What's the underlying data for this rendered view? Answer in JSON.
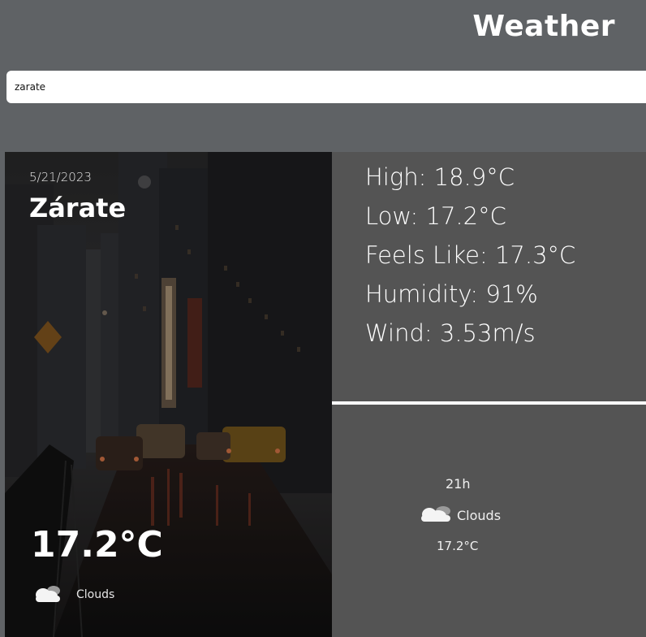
{
  "header": {
    "title": "Weather"
  },
  "search": {
    "value": "zarate"
  },
  "current": {
    "date": "5/21/2023",
    "city": "Zárate",
    "temperature": "17.2°C",
    "condition": "Clouds",
    "condition_icon": "clouds-icon"
  },
  "stats": {
    "high": "High: 18.9°C",
    "low": "Low: 17.2°C",
    "feels_like": "Feels Like: 17.3°C",
    "humidity": "Humidity: 91%",
    "wind": "Wind: 3.53m/s"
  },
  "forecast": [
    {
      "time": "21h",
      "condition": "Clouds",
      "condition_icon": "clouds-icon",
      "temperature": "17.2°C"
    }
  ]
}
